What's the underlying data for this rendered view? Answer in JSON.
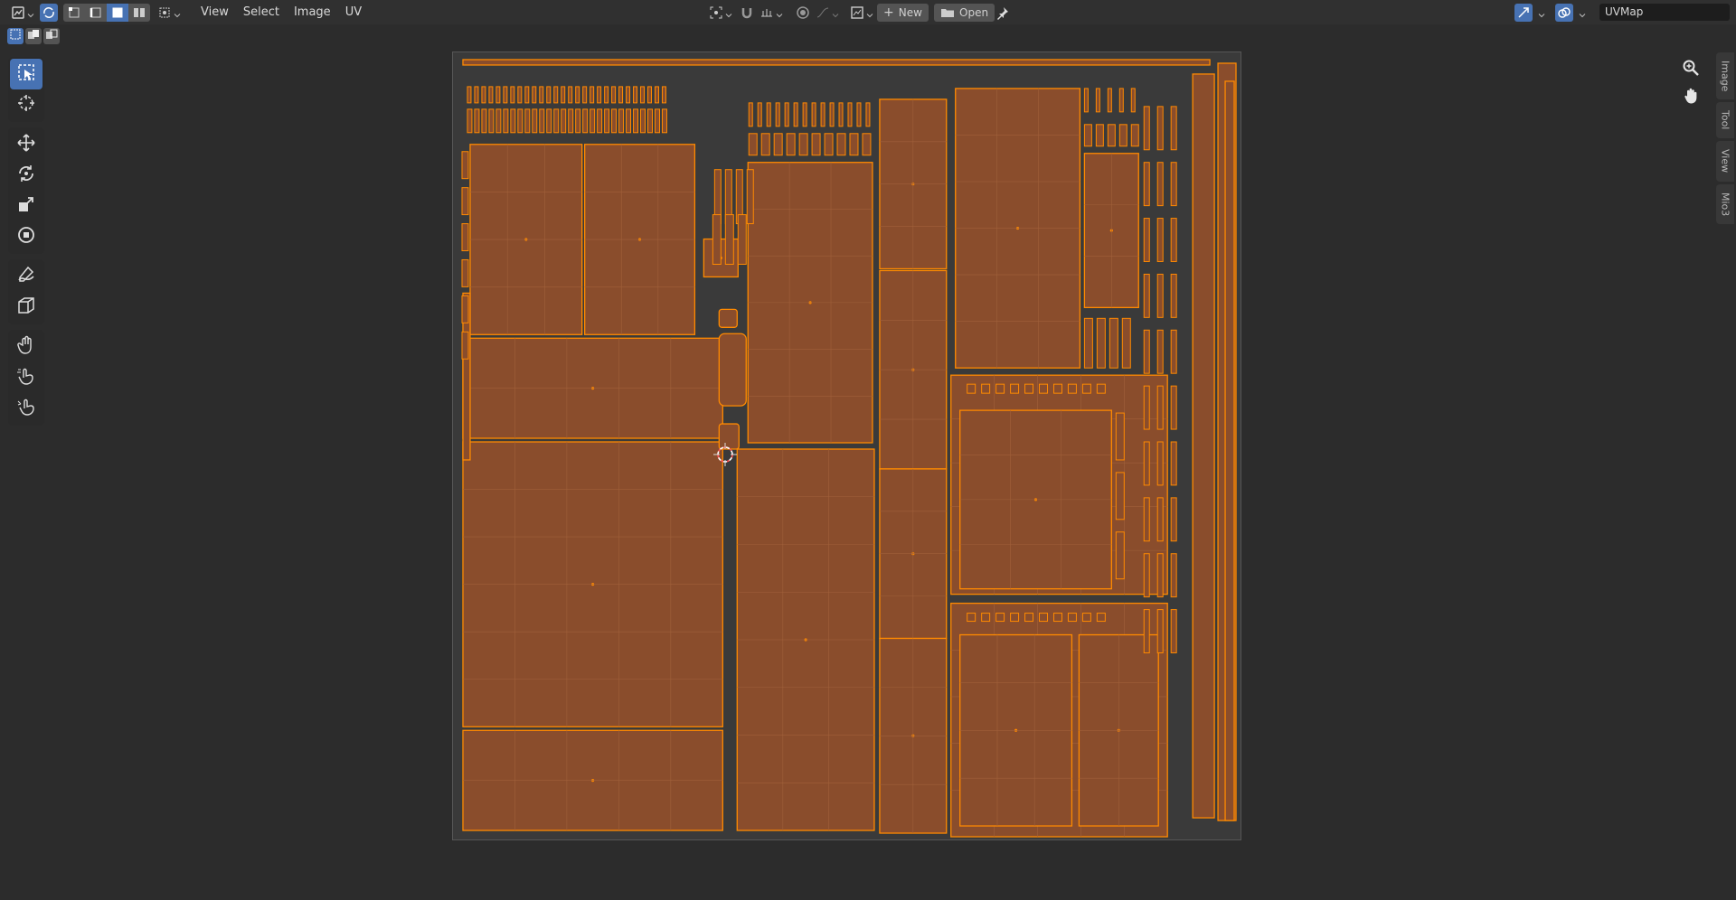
{
  "header": {
    "menus": [
      {
        "label": "View"
      },
      {
        "label": "Select"
      },
      {
        "label": "Image"
      },
      {
        "label": "UV"
      }
    ],
    "new_label": "New",
    "open_label": "Open",
    "uvmap_value": "UVMap"
  },
  "sidebar": {
    "tabs": [
      {
        "label": "Image"
      },
      {
        "label": "Tool"
      },
      {
        "label": "View"
      },
      {
        "label": "Mio3"
      }
    ]
  },
  "toolbar": {
    "tools": [
      {
        "icon": "select-box-icon",
        "active": true
      },
      {
        "icon": "cursor-icon"
      },
      {
        "icon": "move-icon"
      },
      {
        "icon": "rotate-icon"
      },
      {
        "icon": "scale-icon"
      },
      {
        "icon": "transform-icon"
      },
      {
        "icon": "annotate-icon"
      },
      {
        "icon": "rip-icon"
      },
      {
        "icon": "grab-icon"
      },
      {
        "icon": "relax-icon"
      },
      {
        "icon": "pinch-icon"
      }
    ]
  },
  "colors": {
    "accent": "#4772b3",
    "uv_face": "#8a4d2c",
    "uv_edge": "#ff8a00",
    "background": "#2c2c2c"
  }
}
